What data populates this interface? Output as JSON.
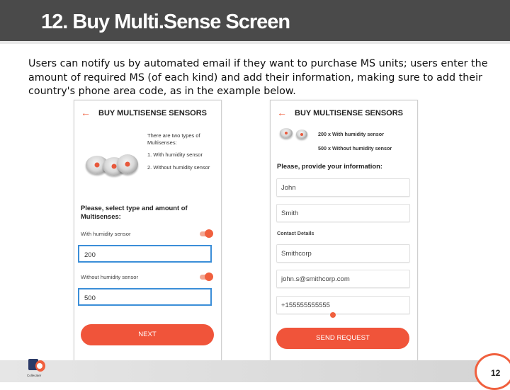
{
  "slide": {
    "title": "12. Buy Multi.Sense Screen",
    "description": "Users can notify us by automated email if they want to purchase MS units; users enter the amount of required MS (of each kind) and add their information, making sure to add their country's phone area code, as in the example below.",
    "page_number": "12",
    "logo_text": "Collecater",
    "accent_color": "#f0603e"
  },
  "left_screen": {
    "back_icon": "arrow-left-icon",
    "header": "BUY MULTISENSE SENSORS",
    "intro": "There are two types of Multisenses:",
    "type1": "1. With humidity sensor",
    "type2": "2. Without humidity sensor",
    "prompt": "Please, select type and amount of Multisenses:",
    "with_label": "With humidity sensor",
    "with_value": "200",
    "without_label": "Without humidity sensor",
    "without_value": "500",
    "next_button": "NEXT"
  },
  "right_screen": {
    "back_icon": "arrow-left-icon",
    "header": "BUY MULTISENSE SENSORS",
    "summary1": "200 x With humidity sensor",
    "summary2": "500 x Without humidity sensor",
    "prompt": "Please, provide your information:",
    "first_name": "John",
    "last_name": "Smith",
    "contact_label": "Contact Details",
    "company": "Smithcorp",
    "email": "john.s@smithcorp.com",
    "phone": "+155555555555",
    "send_button": "SEND REQUEST"
  }
}
